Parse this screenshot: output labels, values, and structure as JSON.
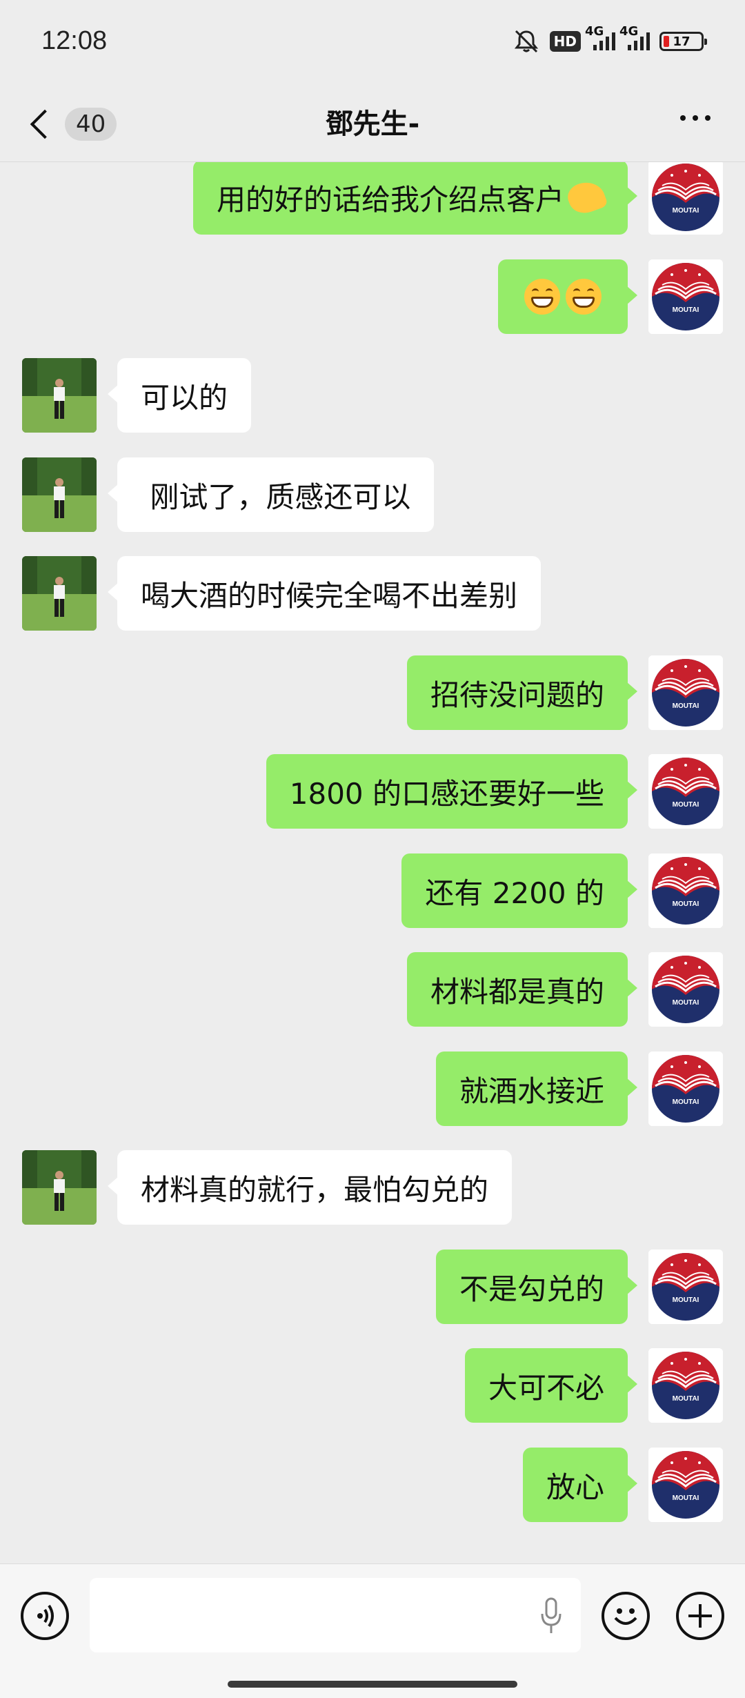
{
  "status_bar": {
    "time": "12:08",
    "hd_label": "HD",
    "network_1": "4G",
    "network_2": "4G",
    "battery": "17"
  },
  "header": {
    "unread_count": "40",
    "title": "鄧先生-"
  },
  "avatars": {
    "me": "moutai-logo",
    "me_logo_text": "MOUTAI",
    "contact": "person-photo"
  },
  "messages": [
    {
      "from": "me",
      "text": "用的好的话给我介绍点客户",
      "emoji": "ok-hand"
    },
    {
      "from": "me",
      "text": "",
      "emoji": "grinning-grinning"
    },
    {
      "from": "contact",
      "text": "可以的"
    },
    {
      "from": "contact",
      "text": " 刚试了，质感还可以"
    },
    {
      "from": "contact",
      "text": "喝大酒的时候完全喝不出差别"
    },
    {
      "from": "me",
      "text": "招待没问题的"
    },
    {
      "from": "me",
      "text": "1800 的口感还要好一些"
    },
    {
      "from": "me",
      "text": "还有 2200 的"
    },
    {
      "from": "me",
      "text": "材料都是真的"
    },
    {
      "from": "me",
      "text": "就酒水接近"
    },
    {
      "from": "contact",
      "text": "材料真的就行，最怕勾兑的"
    },
    {
      "from": "me",
      "text": "不是勾兑的"
    },
    {
      "from": "me",
      "text": "大可不必"
    },
    {
      "from": "me",
      "text": "放心"
    }
  ],
  "input": {
    "value": ""
  },
  "icons": {
    "voice": "voice-icon",
    "mic": "mic-icon",
    "emoji": "smiley-icon",
    "plus": "plus-icon",
    "back": "chevron-left-icon",
    "more": "more-icon"
  }
}
